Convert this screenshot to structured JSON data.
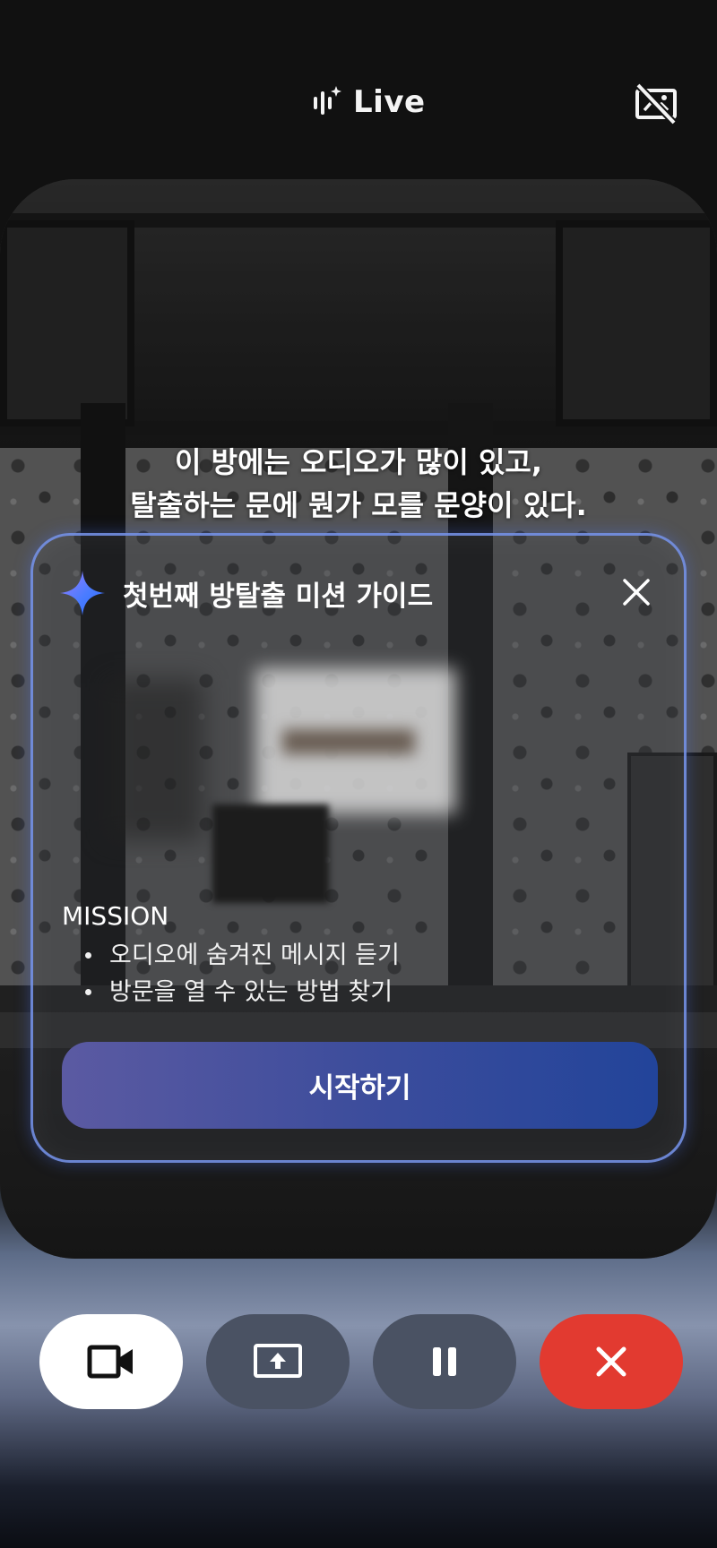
{
  "header": {
    "title": "Live",
    "live_icon": "live-waveform-sparkle-icon",
    "camera_toggle_icon": "camera-off-icon"
  },
  "caption": {
    "line1": "이 방에는 오디오가 많이 있고,",
    "line2": "탈출하는 문에 뭔가 모를 문양이 있다."
  },
  "guide_card": {
    "title": "첫번째 방탈출 미션 가이드",
    "title_icon": "sparkle-icon",
    "close_icon": "close-icon",
    "mission_label": "MISSION",
    "mission_items": [
      "오디오에 숨겨진 메시지 듣기",
      "방문을 열 수 있는 방법 찾기"
    ],
    "start_button": "시작하기",
    "border_color": "#7896f0"
  },
  "controls": {
    "camera_icon": "video-camera-icon",
    "share_screen_icon": "screen-share-icon",
    "pause_icon": "pause-icon",
    "end_icon": "close-icon",
    "end_color": "#e23a30",
    "secondary_color": "#4a5263"
  }
}
